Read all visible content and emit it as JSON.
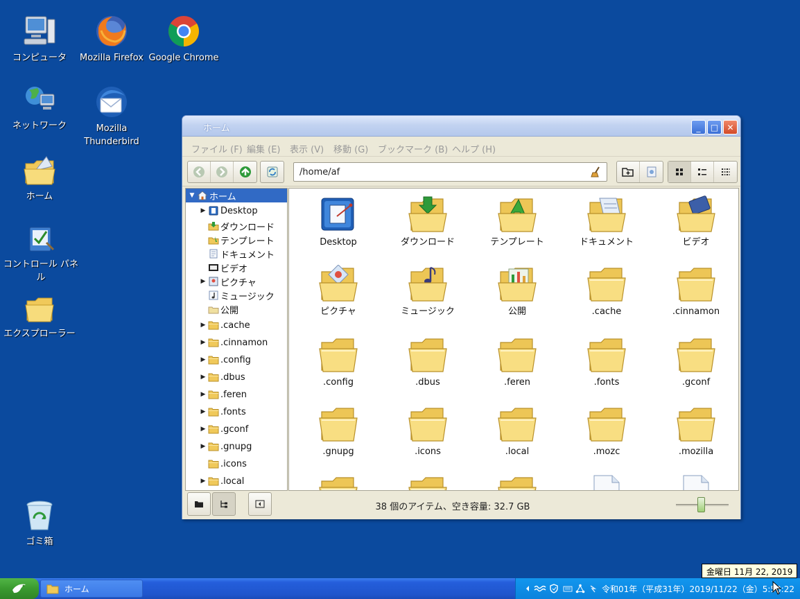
{
  "desktop": {
    "icons": [
      {
        "label": "コンピュータ"
      },
      {
        "label": "Mozilla Firefox"
      },
      {
        "label": "Google Chrome"
      },
      {
        "label": "ネットワーク"
      },
      {
        "label": "Mozilla Thunderbird"
      },
      {
        "label": "ホーム"
      },
      {
        "label": "コントロール パネル"
      },
      {
        "label": "エクスプローラー"
      },
      {
        "label": "ゴミ箱"
      }
    ]
  },
  "window": {
    "title": "ホーム",
    "controls": {
      "minimize": "_",
      "maximize": "□",
      "close": "✕"
    },
    "menu": [
      "ファイル (F)",
      "編集 (E)",
      "表示 (V)",
      "移動 (G)",
      "ブックマーク (B)",
      "ヘルプ (H)"
    ],
    "address": "/home/af",
    "sidebar": [
      {
        "label": "ホーム",
        "expanded": true,
        "selected": true
      },
      {
        "label": "Desktop"
      },
      {
        "label": "ダウンロード"
      },
      {
        "label": "テンプレート"
      },
      {
        "label": "ドキュメント"
      },
      {
        "label": "ビデオ"
      },
      {
        "label": "ピクチャ"
      },
      {
        "label": "ミュージック"
      },
      {
        "label": "公開"
      },
      {
        "label": ".cache"
      },
      {
        "label": ".cinnamon"
      },
      {
        "label": ".config"
      },
      {
        "label": ".dbus"
      },
      {
        "label": ".feren"
      },
      {
        "label": ".fonts"
      },
      {
        "label": ".gconf"
      },
      {
        "label": ".gnupg"
      },
      {
        "label": ".icons"
      },
      {
        "label": ".local"
      }
    ],
    "items": [
      "Desktop",
      "ダウンロード",
      "テンプレート",
      "ドキュメント",
      "ビデオ",
      "ピクチャ",
      "ミュージック",
      "公開",
      ".cache",
      ".cinnamon",
      ".config",
      ".dbus",
      ".feren",
      ".fonts",
      ".gconf",
      ".gnupg",
      ".icons",
      ".local",
      ".mozc",
      ".mozilla"
    ],
    "status": "38 個のアイテム、空き容量: 32.7 GB",
    "zoom_level": 0.48
  },
  "taskbar": {
    "task_label": "ホーム",
    "clock": "令和01年（平成31年）2019/11/22（金）5:58:22",
    "tooltip": "金曜日 11月 22, 2019"
  },
  "colors": {
    "desktop": "#0b4a9e",
    "selection": "#316ac5",
    "folder": "#f5d76e"
  }
}
